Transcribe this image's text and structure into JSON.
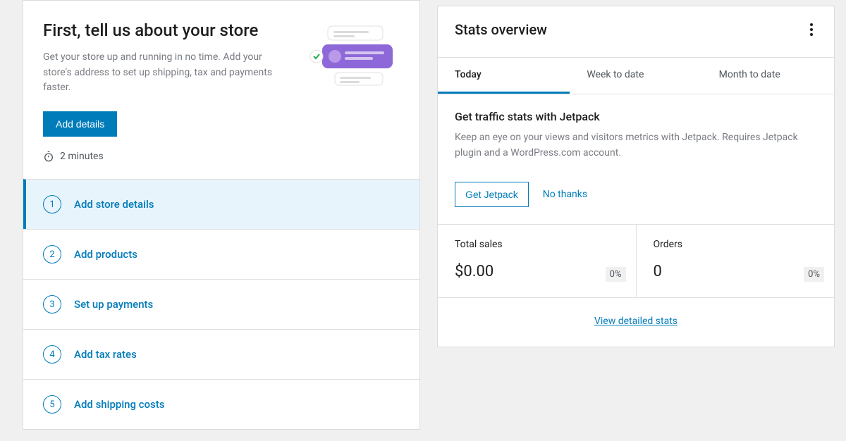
{
  "setup": {
    "title": "First, tell us about your store",
    "description": "Get your store up and running in no time. Add your store's address to set up shipping, tax and payments faster.",
    "button": "Add details",
    "time_estimate": "2 minutes",
    "steps": [
      {
        "num": "1",
        "label": "Add store details",
        "active": true
      },
      {
        "num": "2",
        "label": "Add products",
        "active": false
      },
      {
        "num": "3",
        "label": "Set up payments",
        "active": false
      },
      {
        "num": "4",
        "label": "Add tax rates",
        "active": false
      },
      {
        "num": "5",
        "label": "Add shipping costs",
        "active": false
      }
    ]
  },
  "stats": {
    "title": "Stats overview",
    "tabs": [
      {
        "label": "Today",
        "active": true
      },
      {
        "label": "Week to date",
        "active": false
      },
      {
        "label": "Month to date",
        "active": false
      }
    ],
    "jetpack": {
      "title": "Get traffic stats with Jetpack",
      "description": "Keep an eye on your views and visitors metrics with Jetpack. Requires Jetpack plugin and a WordPress.com account.",
      "get_label": "Get Jetpack",
      "no_thanks_label": "No thanks"
    },
    "cells": [
      {
        "label": "Total sales",
        "value": "$0.00",
        "pct": "0%"
      },
      {
        "label": "Orders",
        "value": "0",
        "pct": "0%"
      }
    ],
    "detailed_link": "View detailed stats"
  }
}
